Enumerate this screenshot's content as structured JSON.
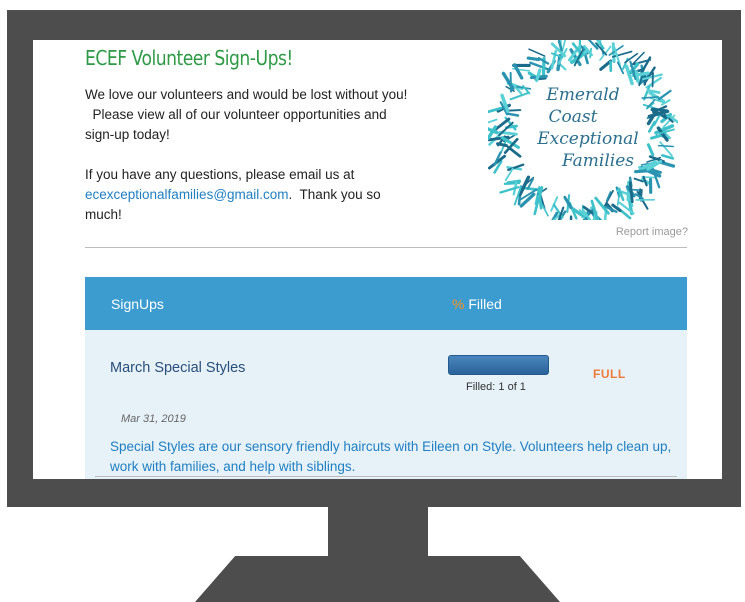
{
  "header": {
    "title": "ECEF Volunteer Sign-Ups!",
    "intro_line1": "We love our volunteers and would be lost without you!",
    "intro_line2": "  Please view all of our volunteer opportunities and",
    "intro_line3": "sign-up today!",
    "contact_prefix": "If you have any questions, please email us at",
    "email": "ecexceptionalfamilies@gmail.com",
    "contact_suffix": ".  Thank you so",
    "contact_end": "much!"
  },
  "logo": {
    "line1": "Emerald",
    "line2": "Coast",
    "line3": "Exceptional",
    "line4": "Families",
    "colors": {
      "wreath_dark": "#1b6b8a",
      "wreath_light": "#3fc1c9",
      "text": "#2b6f8e"
    }
  },
  "report_image_label": "Report image?",
  "table": {
    "col_signups": "SignUps",
    "col_percent_symbol": "%",
    "col_filled": " Filled",
    "header_color": "#3d9ccf",
    "rows": [
      {
        "title": "March Special Styles",
        "progress": 1.0,
        "filled_text": "Filled: 1 of 1",
        "status": "FULL",
        "date": "Mar 31, 2019",
        "description": "Special Styles are our sensory friendly haircuts with Eileen on Style. Volunteers help clean up, work with families, and help with siblings."
      }
    ]
  }
}
